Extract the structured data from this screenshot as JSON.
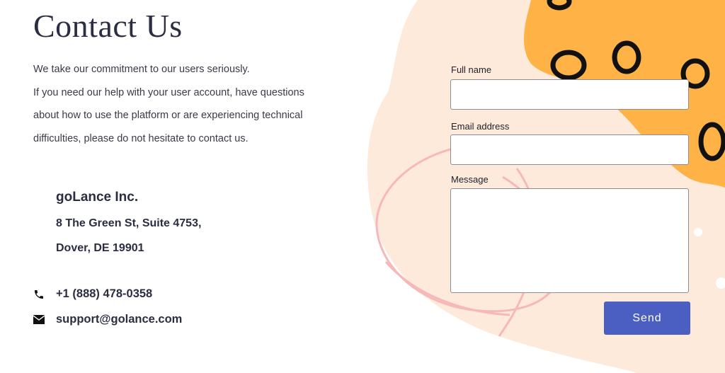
{
  "heading": "Contact Us",
  "intro": {
    "line1": "We take our commitment to our users seriously.",
    "line2": "If you need our help with your user account, have questions about how to use the platform or are experiencing technical difficulties, please do not hesitate to contact us."
  },
  "company": {
    "name": "goLance Inc.",
    "address_line1": "8 The Green St, Suite 4753,",
    "address_line2": "Dover, DE 19901"
  },
  "contact": {
    "phone": "+1 (888) 478-0358",
    "email": "support@golance.com",
    "phone_icon": "phone-icon",
    "email_icon": "envelope-icon"
  },
  "form": {
    "full_name_label": "Full name",
    "full_name_value": "",
    "email_label": "Email address",
    "email_value": "",
    "message_label": "Message",
    "message_value": "",
    "send_label": "Send"
  },
  "colors": {
    "accent": "#4a5fc1",
    "peach_blob": "#fdeadb",
    "orange_splash": "#ffb347",
    "pink_scribble": "#f6b8b8",
    "heading": "#2b2d42"
  }
}
